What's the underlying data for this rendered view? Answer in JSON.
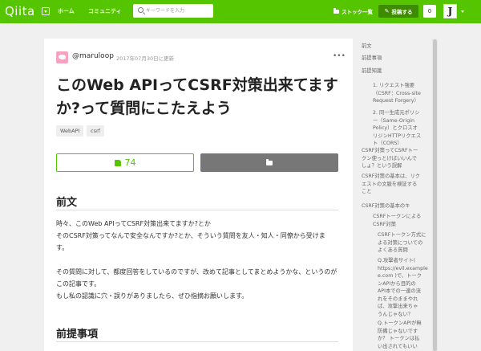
{
  "header": {
    "logo": "Qiita",
    "nav": [
      "ホーム",
      "コミュニティ"
    ],
    "search_placeholder": "キーワードを入力",
    "stock_label": "ストック一覧",
    "post_label": "投稿する",
    "notif_count": "0",
    "user_initial": "J",
    "colors": {
      "brand": "#55c500",
      "post_button": "#3d8c00"
    }
  },
  "article": {
    "author": "@maruloop",
    "date": "2017年07月30日に更新",
    "title_line1": "このWeb APIってCSRF対策出来てます",
    "title_line2": "か?って質問にこたえよう",
    "tags": [
      "WebAPI",
      "csrf"
    ],
    "likes": "74",
    "sections": [
      {
        "heading": "前文",
        "paragraphs": [
          [
            "時々、このWeb APIってCSRF対策出来てますか?とか",
            "そのCSRF対策ってなんで安全なんですか?とか、そういう質問を友人・知人・同僚から受けま",
            "す。"
          ],
          [
            "その質問に対して、都度回答をしているのですが、改めて記事としてまとめようかな、というのが",
            "この記事です。",
            "もし私の認識に穴・誤りがありましたら、ぜひ指摘お願いします。"
          ]
        ]
      },
      {
        "heading": "前提事項"
      }
    ]
  },
  "toc": [
    {
      "level": 0,
      "lines": [
        "前文"
      ]
    },
    {
      "level": 0,
      "lines": [
        "前提事項"
      ]
    },
    {
      "level": 0,
      "lines": [
        "前提知識"
      ]
    },
    {
      "level": 1,
      "lines": [
        "1. リクエスト強要",
        "（CSRF：Cross-site",
        "Request Forgery）"
      ]
    },
    {
      "level": 1,
      "lines": [
        "2. 同一生成元ポリシ",
        "ー（Same-Origin",
        "Policy）とクロスオ",
        "リジンHTTPリクエス",
        "ト（CORS）"
      ]
    },
    {
      "level": 0,
      "lines": [
        "CSRF対策ってCSRFトー",
        "クン使っとけばいいんで",
        "しょ？という誤解"
      ]
    },
    {
      "level": 0,
      "lines": [
        "CSRF対策の基本は、リク",
        "エストの文脈を検証する",
        "こと"
      ]
    },
    {
      "level": 0,
      "lines": [
        "CSRF対策の基本のキ"
      ]
    },
    {
      "level": 1,
      "lines": [
        "CSRFトークンによる",
        "CSRF対策"
      ]
    },
    {
      "level": 2,
      "lines": [
        "CSRFトークン方式に",
        "よる対策についての",
        "よくある質問"
      ]
    },
    {
      "level": 3,
      "lines": [
        "Q.攻撃者サイト(",
        "https://evil.example",
        "e.com )で、トーク",
        "ンAPIから目的の",
        "API本での一連の流",
        "れをそのままやれ",
        "ば、攻撃出来ちゃ",
        "うんじゃない？"
      ]
    },
    {
      "level": 3,
      "lines": [
        "Q.トークンAPIが無",
        "防備じゃないです",
        "か？ トークンは払",
        "い出されてもいい"
      ]
    }
  ]
}
